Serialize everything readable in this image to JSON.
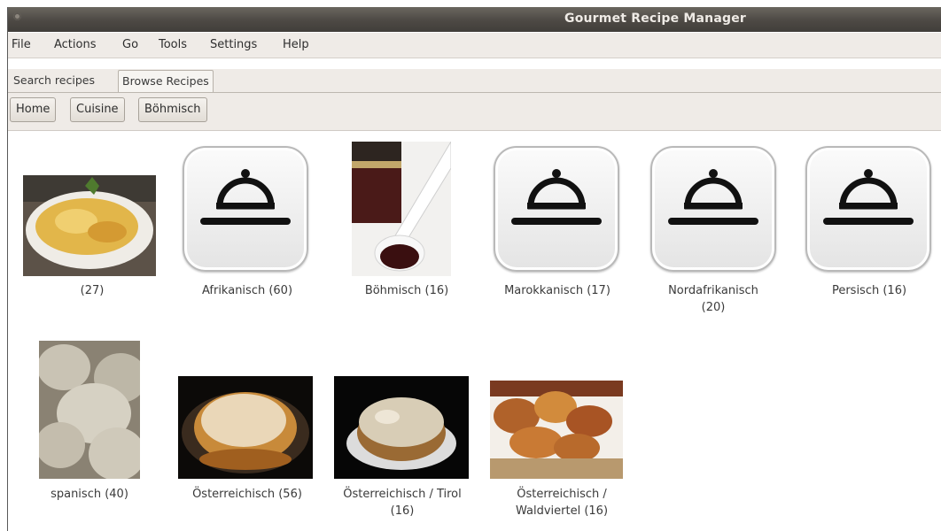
{
  "window": {
    "title": "Gourmet Recipe Manager"
  },
  "menubar": {
    "items": [
      "File",
      "Actions",
      "Go",
      "Tools",
      "Settings",
      "Help"
    ]
  },
  "tabs": [
    {
      "label": "Search recipes",
      "active": false
    },
    {
      "label": "Browse Recipes",
      "active": true
    }
  ],
  "breadcrumbs": [
    "Home",
    "Cuisine",
    "Böhmisch"
  ],
  "items": [
    {
      "label": "(27)",
      "icon": "photo-pasta"
    },
    {
      "label": "Afrikanisch (60)",
      "icon": "dome-icon"
    },
    {
      "label": "Böhmisch (16)",
      "icon": "photo-jam"
    },
    {
      "label": "Marokkanisch (17)",
      "icon": "dome-icon"
    },
    {
      "label": "Nordafrikanisch (20)",
      "icon": "dome-icon"
    },
    {
      "label": "Persisch (16)",
      "icon": "dome-icon"
    },
    {
      "label": "spanisch (40)",
      "icon": "photo-potatoes"
    },
    {
      "label": "Österreichisch (56)",
      "icon": "photo-souffle"
    },
    {
      "label": "Österreichisch / Tirol (16)",
      "icon": "photo-cake"
    },
    {
      "label": "Österreichisch / Waldviertel (16)",
      "icon": "photo-pastries"
    }
  ],
  "colors": {
    "titlebar": "#4d4944",
    "menubar": "#efebe7",
    "content": "#ffffff"
  }
}
